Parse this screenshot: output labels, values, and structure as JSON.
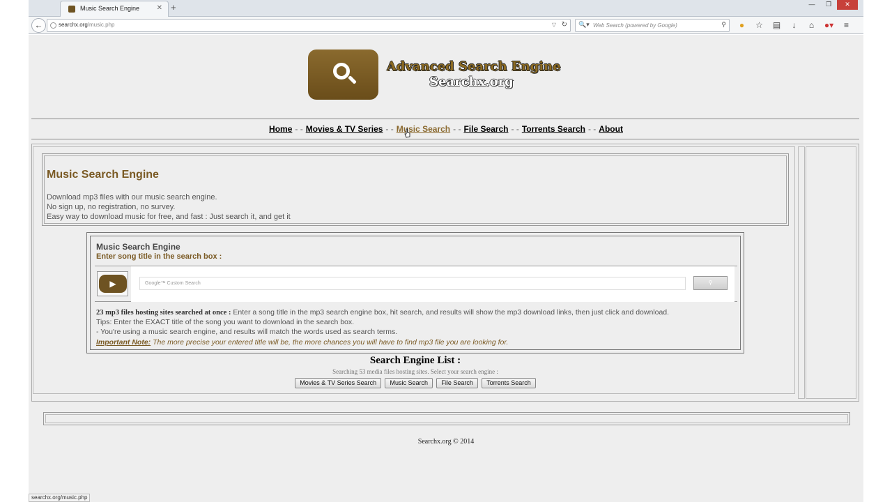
{
  "browser": {
    "tab_title": "Music Search Engine",
    "tab_close": "✕",
    "new_tab": "+",
    "url_host": "searchx.org",
    "url_path": "/music.php",
    "search_placeholder": "Web Search (powered by Google)",
    "window_controls": {
      "minimize": "—",
      "restore": "❐",
      "close": "✕"
    },
    "status_text": "searchx.org/music.php"
  },
  "site": {
    "logo_title": "Advanced Search Engine",
    "logo_subtitle": "Searchx.org",
    "nav": [
      {
        "label": "Home",
        "active": false
      },
      {
        "label": "Movies & TV Series",
        "active": false
      },
      {
        "label": "Music Search",
        "active": true
      },
      {
        "label": "File Search",
        "active": false
      },
      {
        "label": "Torrents Search",
        "active": false
      },
      {
        "label": "About",
        "active": false
      }
    ],
    "nav_separator": "- -"
  },
  "intro": {
    "title": "Music Search Engine",
    "lines": [
      "Download mp3 files with our music search engine.",
      "No sign up, no registration, no survey.",
      "Easy way to download music for free, and fast : Just search it, and get it"
    ]
  },
  "search_box": {
    "title": "Music Search Engine",
    "subtitle": "Enter song title in the search box :",
    "placeholder": "Google™ Custom Search",
    "info_bold": "23 mp3 files hosting sites searched at once :",
    "info_text": " Enter a song title in the mp3 search engine box, hit search, and results will show the mp3 download links, then just click and download.",
    "tip1": "Tips: Enter the EXACT title of the song you want to download in the search box.",
    "tip2": "- You're using a music search engine, and results will match the words used as search terms.",
    "note_label": "Important Note:",
    "note_text": " The more precise your entered title will be, the more chances you will have to find mp3 file you are looking for."
  },
  "engine_list": {
    "title": "Search Engine List :",
    "subtitle": "Searching 53 media files hosting sites. Select your search engine :",
    "buttons": [
      "Movies & TV Series Search",
      "Music Search",
      "File Search",
      "Torrents Search"
    ]
  },
  "footer": {
    "copyright": "Searchx.org © 2014"
  },
  "colors": {
    "accent_brown": "#7a5a24",
    "page_bg": "#eeeeee"
  }
}
